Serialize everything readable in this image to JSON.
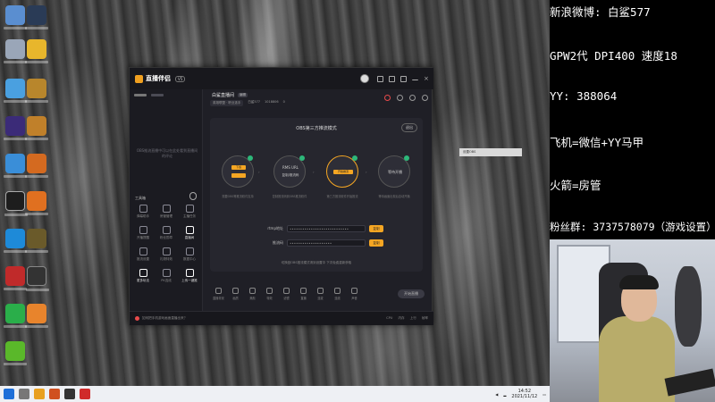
{
  "app": {
    "name": "直播伴侣",
    "version": "V5",
    "sidebar": {
      "empty_hint": "OBS推流直播中可以在此处看到直播间的评论",
      "tools_title": "工具箱",
      "tools": [
        {
          "label": "弹幕助手",
          "icon": "danmaku-icon"
        },
        {
          "label": "房管管理",
          "icon": "admin-icon"
        },
        {
          "label": "主播任务",
          "icon": "task-icon"
        },
        {
          "label": "开播提醒",
          "icon": "notify-icon"
        },
        {
          "label": "粉丝勋章",
          "icon": "badge-icon"
        },
        {
          "label": "直播间",
          "icon": "room-icon",
          "active": true
        },
        {
          "label": "推流设置",
          "icon": "settings-icon"
        },
        {
          "label": "礼物特效",
          "icon": "gift-icon"
        },
        {
          "label": "数据中心",
          "icon": "data-icon"
        },
        {
          "label": "更多玩法",
          "icon": "more-icon",
          "active": true
        },
        {
          "label": "PK连线",
          "icon": "pk-icon"
        },
        {
          "label": "上传一键推",
          "icon": "upload-icon",
          "active": true
        }
      ]
    },
    "room": {
      "title": "白鲨直播间",
      "tag": "编辑",
      "category": "英雄联盟 · 职业选手",
      "id": "白鲨577",
      "fans": "1018806",
      "hot": "0"
    },
    "stream": {
      "mode_title": "OBS第三方推流模式",
      "exit_label": "退出",
      "steps": [
        {
          "button": "下载",
          "caption": "需要OBS等推流软件支持"
        },
        {
          "main": "RMS URL",
          "sub": "复制/推流码",
          "caption": "复制推流码到OBS推流软件"
        },
        {
          "button": "开始推流",
          "caption": "第三方推流软件开始推流"
        },
        {
          "text": "等待开播",
          "caption": "等待画面出现后自动开播"
        }
      ],
      "fields": [
        {
          "label": "rtmp地址",
          "value": "••••••••••••••••••••••••••••",
          "copy": "复制"
        },
        {
          "label": "推流码",
          "value": "••••••••••••••••••••",
          "copy": "复制"
        }
      ],
      "helper": "切换回OBS推流模式请到设置中 下次免费重新获取"
    },
    "bottom_tools": [
      "直播背景",
      "画质",
      "美颜",
      "特效",
      "滤镜",
      "直播",
      "连麦",
      "连线",
      "声音"
    ],
    "start_live": "开始直播",
    "status": {
      "message": "如何把手机游戏画面直播出来？",
      "stats": [
        "CPU",
        "内存",
        "上行",
        "帧率"
      ]
    },
    "tooltip": "设置OBS"
  },
  "taskbar": {
    "time": "14:52",
    "date": "2021/11/12"
  },
  "info": {
    "lines": [
      "新浪微博: 白鲨577",
      "GPW2代 DPI400 速度18",
      "YY: 388064",
      "飞机=微信+YY马甲",
      "火箭=房管",
      "粉丝群: 3737578079（游戏设置）"
    ]
  },
  "colors": {
    "accent": "#f5a623",
    "success": "#2db87a",
    "window_bg": "#1f1f26"
  }
}
